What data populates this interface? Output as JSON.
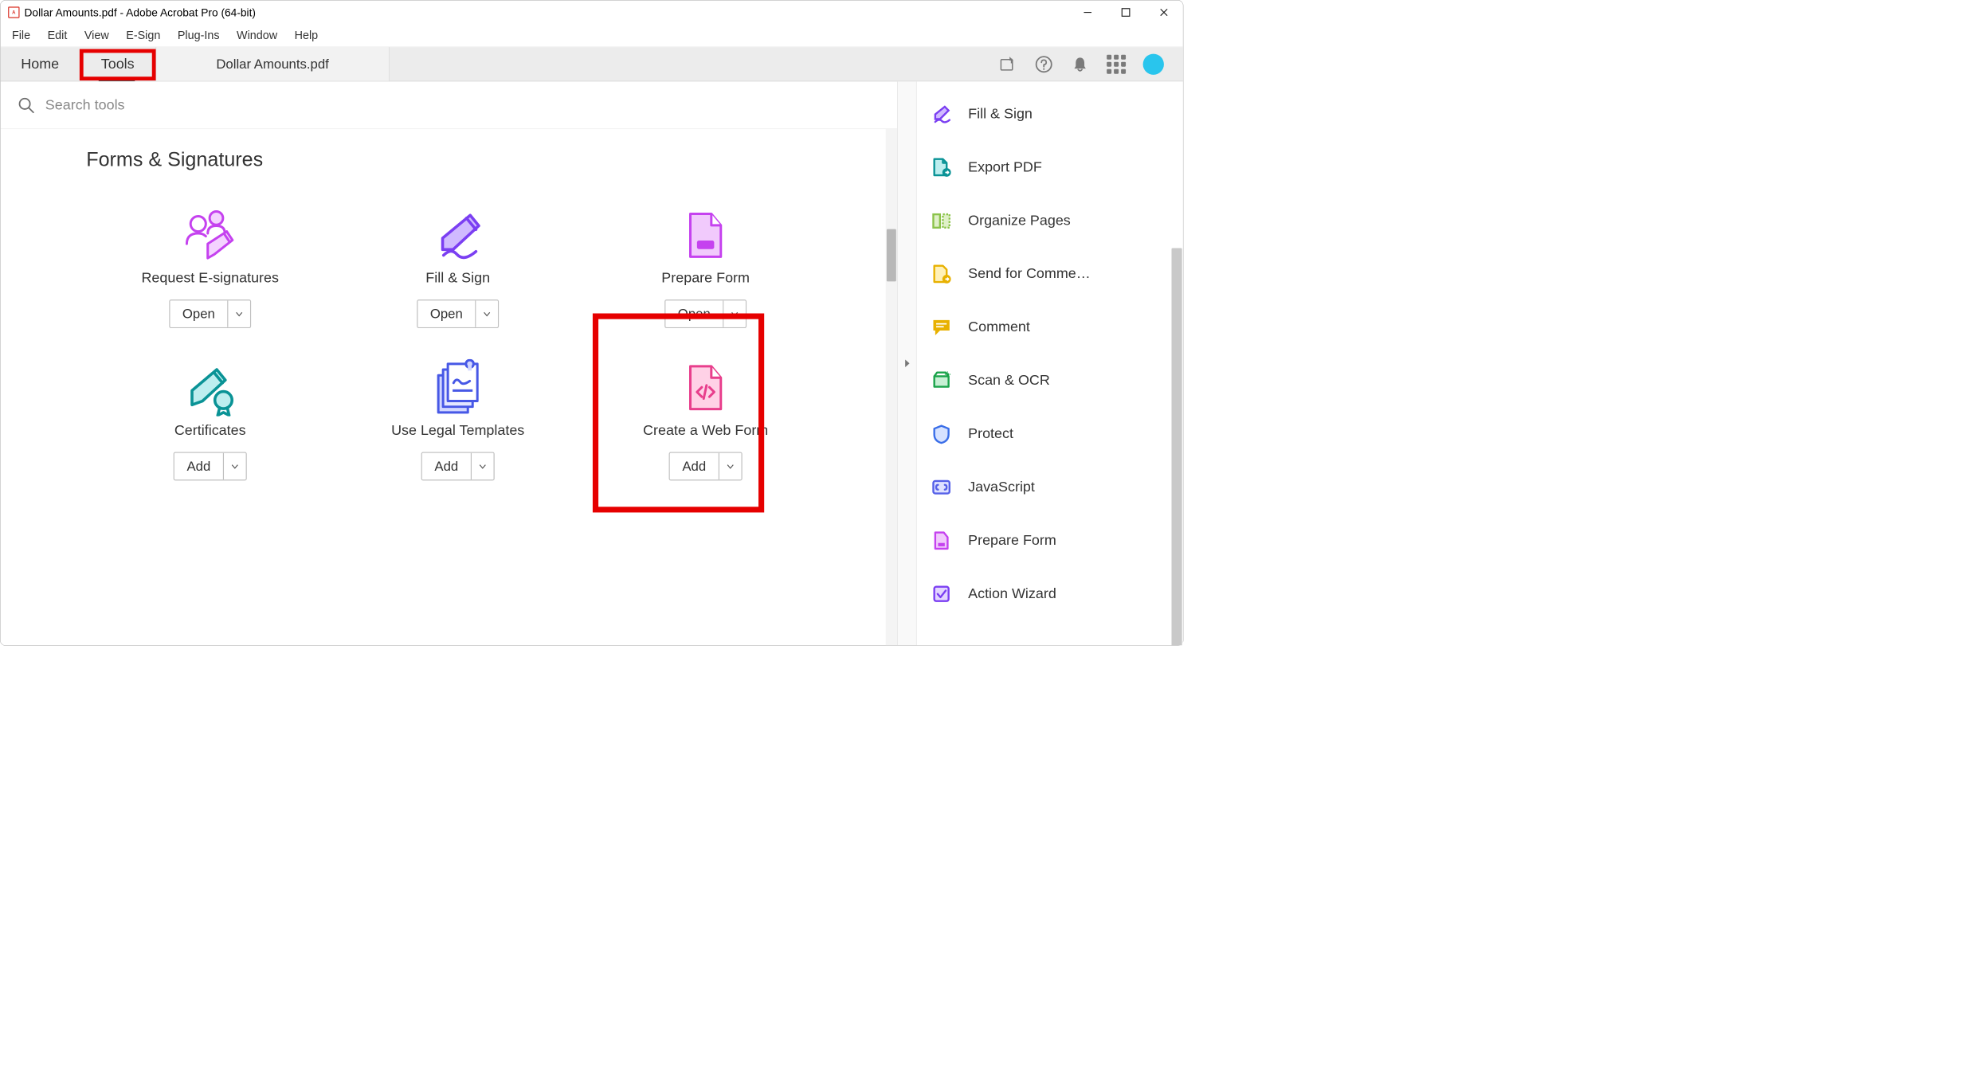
{
  "window": {
    "title": "Dollar Amounts.pdf - Adobe Acrobat Pro (64-bit)"
  },
  "menu": [
    "File",
    "Edit",
    "View",
    "E-Sign",
    "Plug-Ins",
    "Window",
    "Help"
  ],
  "tabs": {
    "home": "Home",
    "tools": "Tools",
    "doc": "Dollar Amounts.pdf"
  },
  "search": {
    "placeholder": "Search tools"
  },
  "section": {
    "title": "Forms & Signatures"
  },
  "tools": {
    "request": {
      "label": "Request E-signatures",
      "btn": "Open"
    },
    "fillsign": {
      "label": "Fill & Sign",
      "btn": "Open"
    },
    "prepare": {
      "label": "Prepare Form",
      "btn": "Open"
    },
    "cert": {
      "label": "Certificates",
      "btn": "Add"
    },
    "legal": {
      "label": "Use Legal Templates",
      "btn": "Add"
    },
    "webform": {
      "label": "Create a Web Form",
      "btn": "Add"
    }
  },
  "sidebar": [
    {
      "label": "Fill & Sign"
    },
    {
      "label": "Export PDF"
    },
    {
      "label": "Organize Pages"
    },
    {
      "label": "Send for Comme…"
    },
    {
      "label": "Comment"
    },
    {
      "label": "Scan & OCR"
    },
    {
      "label": "Protect"
    },
    {
      "label": "JavaScript"
    },
    {
      "label": "Prepare Form"
    },
    {
      "label": "Action Wizard"
    }
  ],
  "highlights": [
    "tools-tab",
    "prepare-form-card"
  ]
}
